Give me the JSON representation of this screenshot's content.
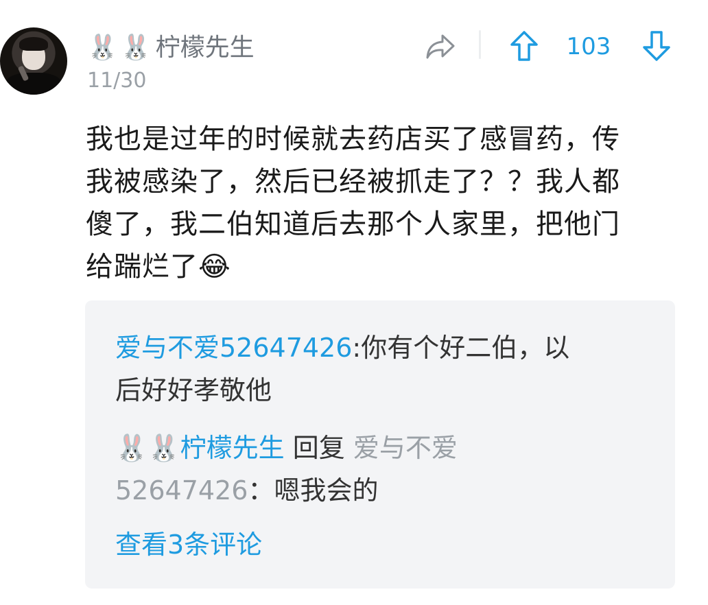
{
  "comment": {
    "author": {
      "emoji": [
        "🐰",
        "🐰"
      ],
      "name": "柠檬先生"
    },
    "date": "11/30",
    "vote_count": "103",
    "body_lines": [
      "我也是过年的时候就去药店买了感冒药，传",
      "我被感染了，然后已经被抓走了？？我人都",
      "傻了，我二伯知道后去那个人家里，把他门",
      "给踹烂了"
    ],
    "body_emoji": "😂",
    "icons": {
      "share": "share-icon",
      "upvote": "arrow-up-icon",
      "downvote": "arrow-down-icon"
    },
    "colors": {
      "accent": "#1e9be0",
      "muted": "#9aa0a6",
      "reply_bg": "#f3f4f6"
    }
  },
  "replies": [
    {
      "author": "爱与不爱52647426",
      "separator": ":",
      "line1": "你有个好二伯，以",
      "line2": "后好好孝敬他"
    },
    {
      "author_emoji": [
        "🐰",
        "🐰"
      ],
      "author": "柠檬先生",
      "reply_word": "回复",
      "target_part1": "爱与不爱",
      "target_part2": "52647426",
      "separator": "：",
      "text": "嗯我会的"
    }
  ],
  "view_more": "查看3条评论"
}
